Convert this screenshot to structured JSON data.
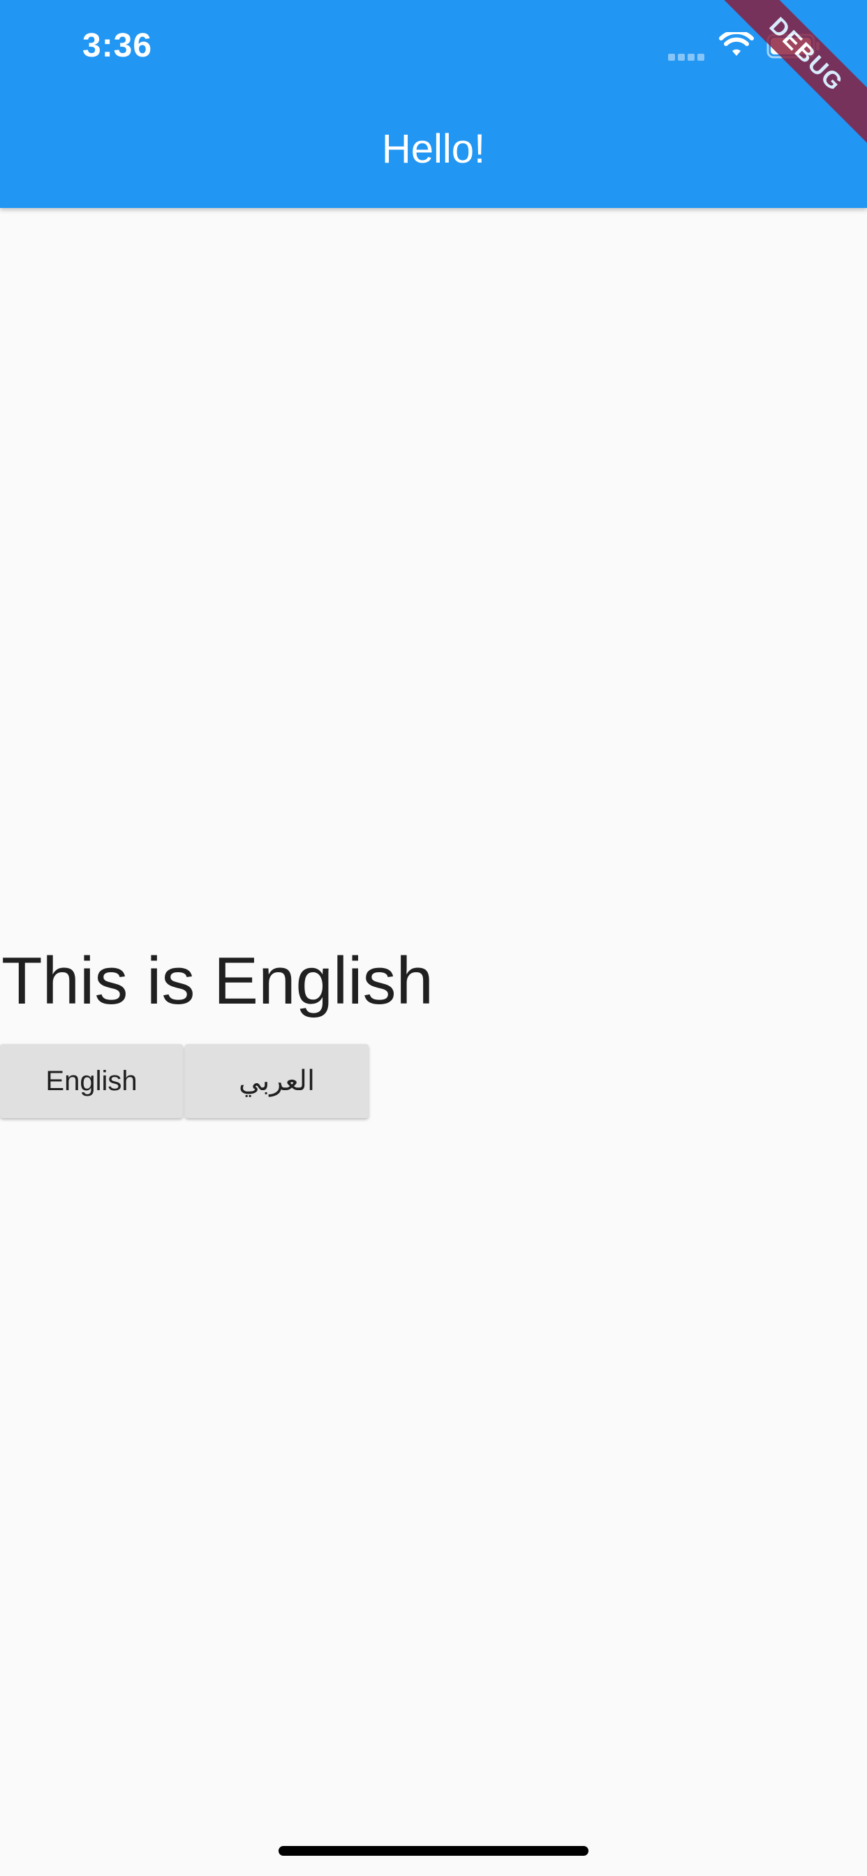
{
  "status_bar": {
    "time": "3:36",
    "icons": [
      "signal-icon",
      "wifi-icon",
      "battery-icon"
    ]
  },
  "app_bar": {
    "title": "Hello!",
    "background_color": "#2196f3"
  },
  "debug_banner": {
    "label": "DEBUG",
    "color": "#8b1d3b"
  },
  "content": {
    "message": "This is English",
    "buttons": [
      {
        "label": "English"
      },
      {
        "label": "العربي"
      }
    ]
  }
}
